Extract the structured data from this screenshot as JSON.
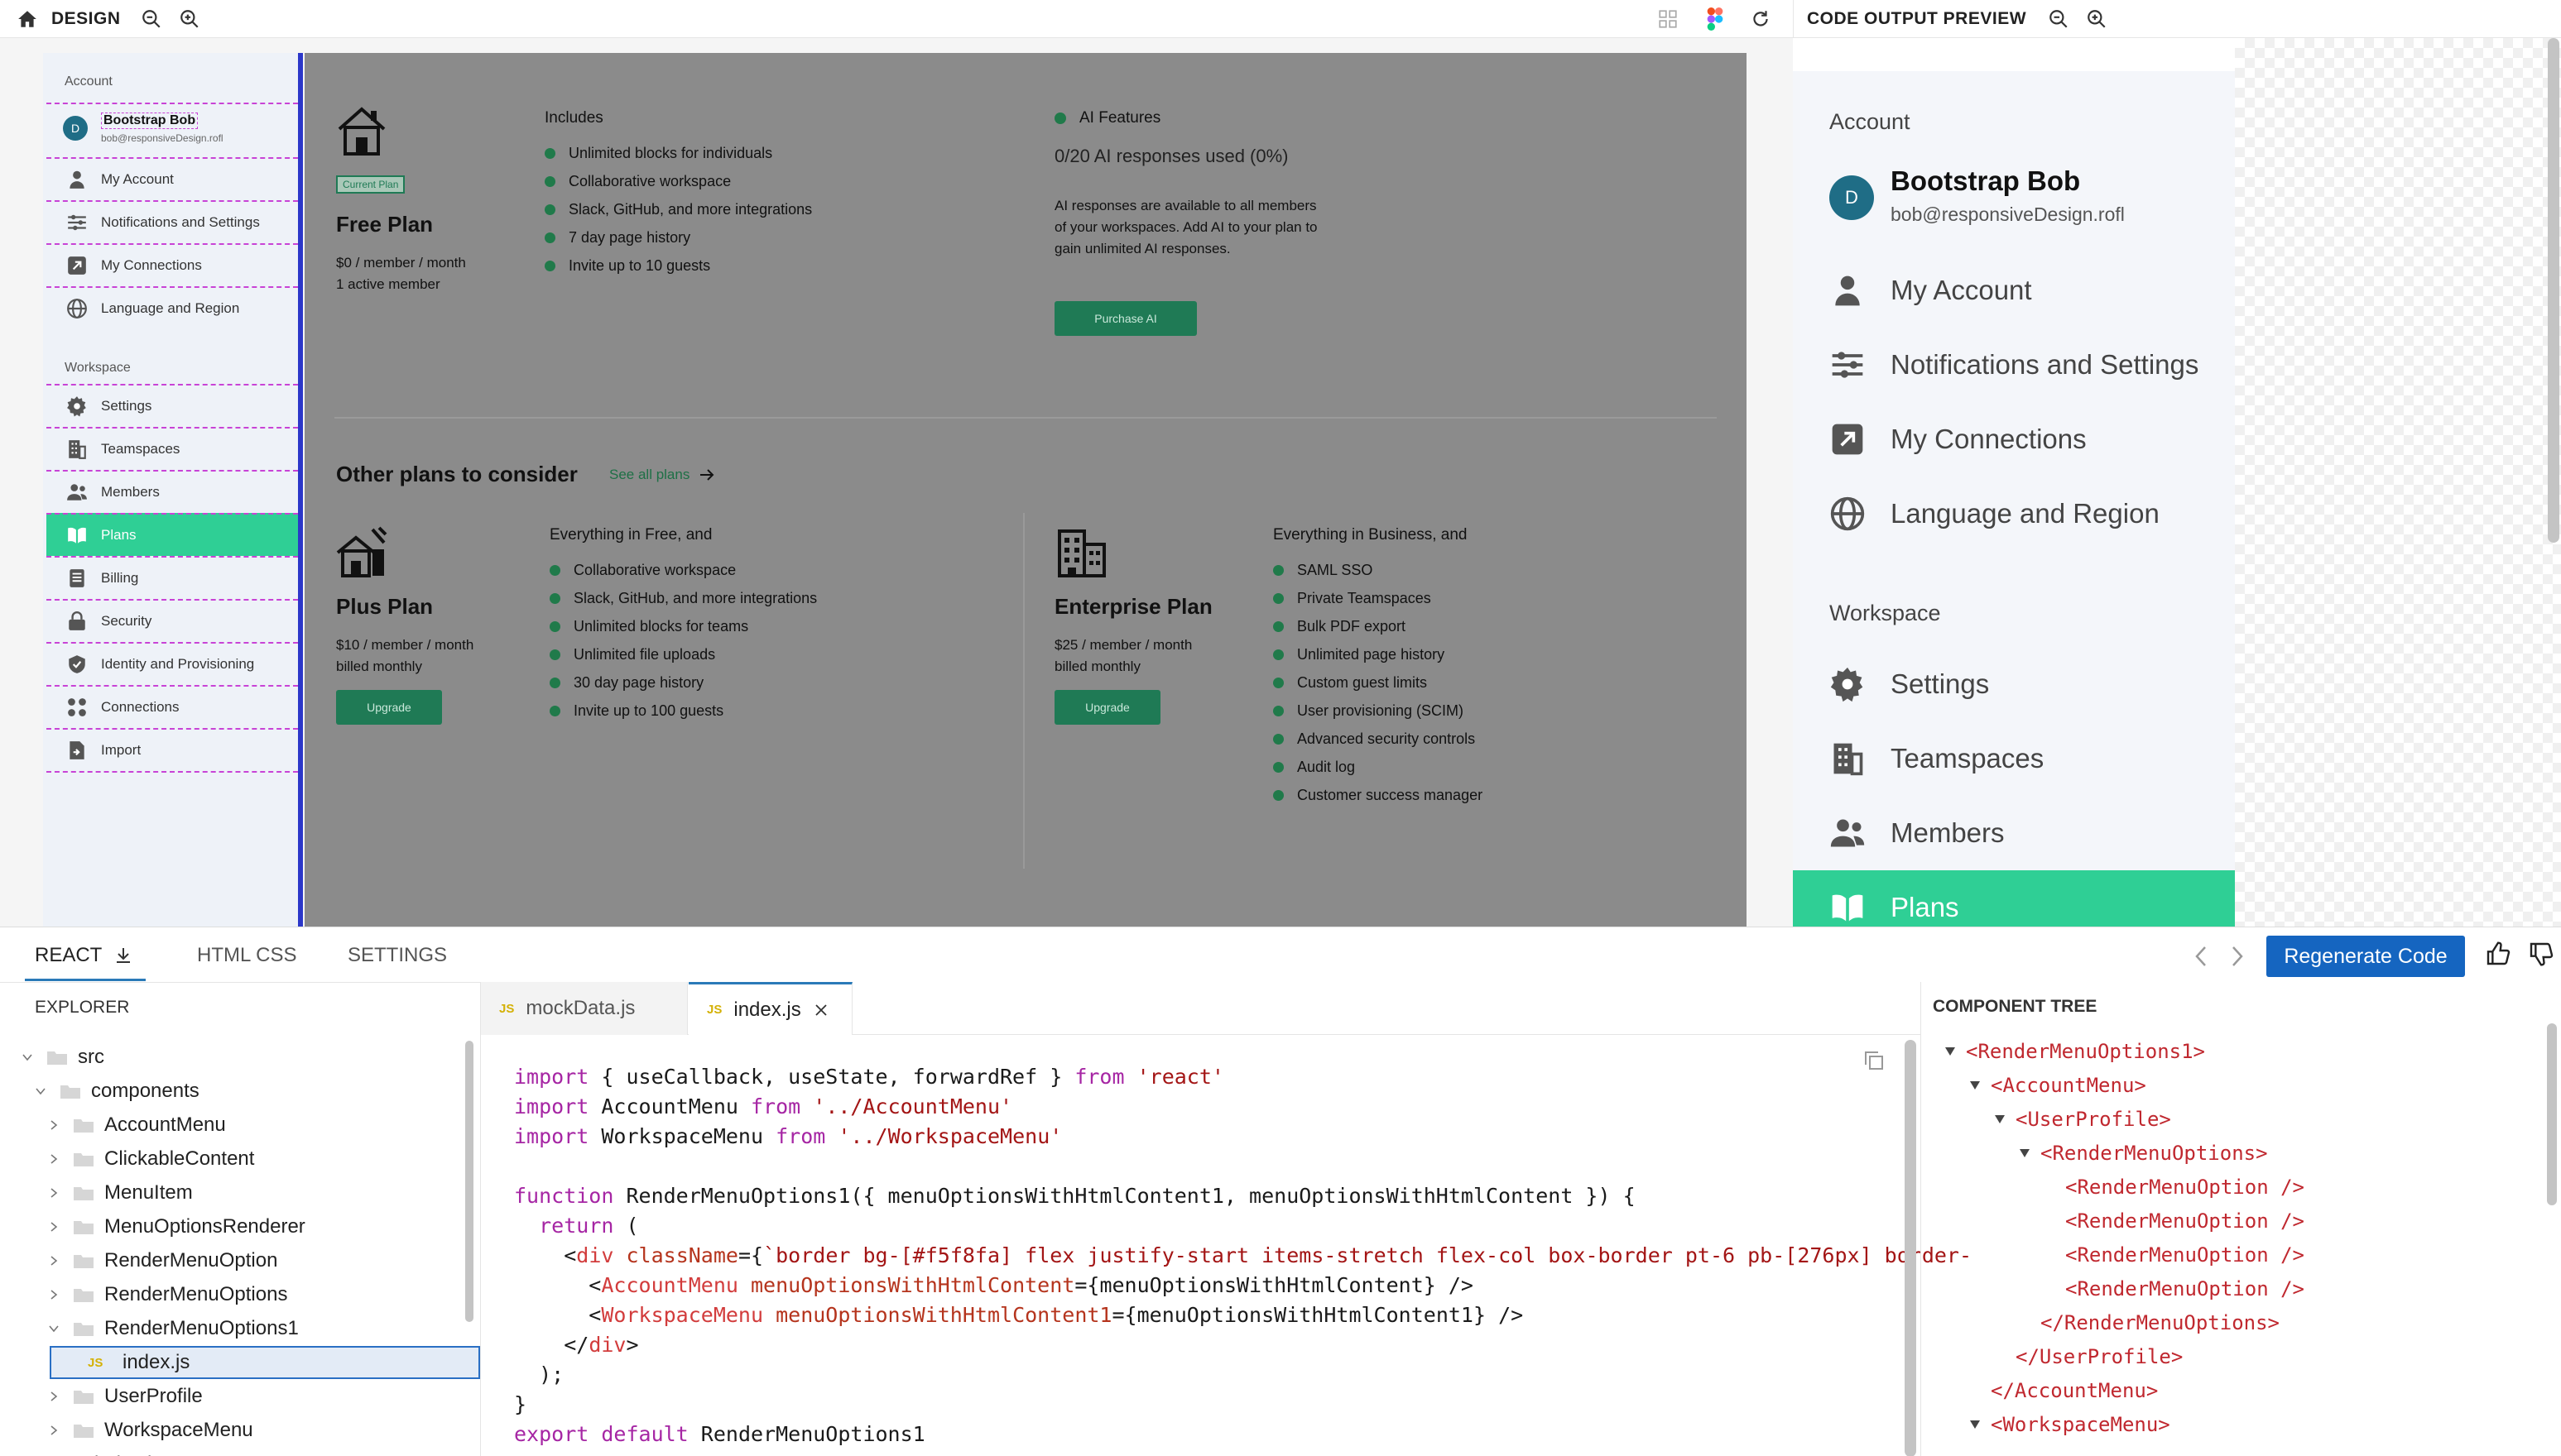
{
  "design_bar": {
    "title": "DESIGN"
  },
  "preview_bar": {
    "title": "CODE OUTPUT PREVIEW"
  },
  "design_sidebar": {
    "account_label": "Account",
    "profile": {
      "initial": "D",
      "name": "Bootstrap Bob",
      "email": "bob@responsiveDesign.rofl"
    },
    "account_items": [
      "My Account",
      "Notifications and Settings",
      "My Connections",
      "Language and Region"
    ],
    "workspace_label": "Workspace",
    "workspace_items": [
      "Settings",
      "Teamspaces",
      "Members",
      "Plans",
      "Billing",
      "Security",
      "Identity and Provisioning",
      "Connections",
      "Import"
    ],
    "active_item": "Plans"
  },
  "plans": {
    "current_badge": "Current Plan",
    "free": {
      "name": "Free Plan",
      "price": "$0 / member / month",
      "members": "1 active member"
    },
    "includes_title": "Includes",
    "includes": [
      "Unlimited blocks for individuals",
      "Collaborative workspace",
      "Slack, GitHub, and more integrations",
      "7 day page history",
      "Invite up to 10 guests"
    ],
    "ai": {
      "title": "AI Features",
      "usage": "0/20 AI responses used (0%)",
      "description_lines": [
        "AI responses are available to all members",
        "of your workspaces. Add AI to your plan to",
        "gain unlimited AI responses."
      ],
      "button": "Purchase AI"
    },
    "other_title": "Other plans to consider",
    "see_all": "See all plans",
    "plus": {
      "name": "Plus Plan",
      "price": "$10 / member / month",
      "billing": "billed monthly",
      "button": "Upgrade",
      "features_title": "Everything in Free, and",
      "features": [
        "Collaborative workspace",
        "Slack, GitHub, and more integrations",
        "Unlimited blocks for teams",
        "Unlimited file uploads",
        "30 day page history",
        "Invite up to 100 guests"
      ]
    },
    "enterprise": {
      "name": "Enterprise Plan",
      "price": "$25 / member / month",
      "billing": "billed monthly",
      "button": "Upgrade",
      "features_title": "Everything in Business, and",
      "features": [
        "SAML SSO",
        "Private Teamspaces",
        "Bulk PDF export",
        "Unlimited page history",
        "Custom guest limits",
        "User provisioning (SCIM)",
        "Advanced security controls",
        "Audit log",
        "Customer success manager"
      ]
    }
  },
  "preview": {
    "account_label": "Account",
    "profile": {
      "initial": "D",
      "name": "Bootstrap Bob",
      "email": "bob@responsiveDesign.rofl"
    },
    "account_items": [
      "My Account",
      "Notifications and Settings",
      "My Connections",
      "Language and Region"
    ],
    "workspace_label": "Workspace",
    "workspace_items": [
      "Settings",
      "Teamspaces",
      "Members",
      "Plans"
    ],
    "active_item": "Plans"
  },
  "bottom_tabs": {
    "react": "REACT",
    "html_css": "HTML CSS",
    "settings": "SETTINGS"
  },
  "actions": {
    "regenerate": "Regenerate Code"
  },
  "explorer": {
    "title": "EXPLORER",
    "tree": [
      {
        "label": "src",
        "depth": 0,
        "type": "folder",
        "open": true
      },
      {
        "label": "components",
        "depth": 1,
        "type": "folder",
        "open": true
      },
      {
        "label": "AccountMenu",
        "depth": 2,
        "type": "folder",
        "open": false
      },
      {
        "label": "ClickableContent",
        "depth": 2,
        "type": "folder",
        "open": false
      },
      {
        "label": "MenuItem",
        "depth": 2,
        "type": "folder",
        "open": false
      },
      {
        "label": "MenuOptionsRenderer",
        "depth": 2,
        "type": "folder",
        "open": false
      },
      {
        "label": "RenderMenuOption",
        "depth": 2,
        "type": "folder",
        "open": false
      },
      {
        "label": "RenderMenuOptions",
        "depth": 2,
        "type": "folder",
        "open": false
      },
      {
        "label": "RenderMenuOptions1",
        "depth": 2,
        "type": "folder",
        "open": true
      },
      {
        "label": "index.js",
        "depth": 3,
        "type": "file",
        "selected": true
      },
      {
        "label": "UserProfile",
        "depth": 2,
        "type": "folder",
        "open": false
      },
      {
        "label": "WorkspaceMenu",
        "depth": 2,
        "type": "folder",
        "open": false
      },
      {
        "label": "index.js",
        "depth": 1,
        "type": "file"
      }
    ]
  },
  "editor": {
    "tabs": [
      {
        "label": "mockData.js",
        "active": false
      },
      {
        "label": "index.js",
        "active": true
      }
    ],
    "file_icon_label": "JS",
    "lines": [
      "import { useCallback, useState, forwardRef } from 'react'",
      "import AccountMenu from '../AccountMenu'",
      "import WorkspaceMenu from '../WorkspaceMenu'",
      "",
      "function RenderMenuOptions1({ menuOptionsWithHtmlContent1, menuOptionsWithHtmlContent }) {",
      "  return (",
      "    <div className={`border bg-[#f5f8fa] flex justify-start items-stretch flex-col box-border pt-6 pb-[276px] border-",
      "      <AccountMenu menuOptionsWithHtmlContent={menuOptionsWithHtmlContent} />",
      "      <WorkspaceMenu menuOptionsWithHtmlContent1={menuOptionsWithHtmlContent1} />",
      "    </div>",
      "  );",
      "}",
      "export default RenderMenuOptions1"
    ]
  },
  "component_tree": {
    "title": "COMPONENT TREE",
    "rows": [
      {
        "label": "<RenderMenuOptions1>",
        "depth": 0,
        "toggle": true
      },
      {
        "label": "<AccountMenu>",
        "depth": 1,
        "toggle": true
      },
      {
        "label": "<UserProfile>",
        "depth": 2,
        "toggle": true
      },
      {
        "label": "<RenderMenuOptions>",
        "depth": 3,
        "toggle": true
      },
      {
        "label": "<RenderMenuOption />",
        "depth": 4,
        "toggle": false
      },
      {
        "label": "<RenderMenuOption />",
        "depth": 4,
        "toggle": false
      },
      {
        "label": "<RenderMenuOption />",
        "depth": 4,
        "toggle": false
      },
      {
        "label": "<RenderMenuOption />",
        "depth": 4,
        "toggle": false
      },
      {
        "label": "</RenderMenuOptions>",
        "depth": 3,
        "toggle": false
      },
      {
        "label": "</UserProfile>",
        "depth": 2,
        "toggle": false
      },
      {
        "label": "</AccountMenu>",
        "depth": 1,
        "toggle": false
      },
      {
        "label": "<WorkspaceMenu>",
        "depth": 1,
        "toggle": true
      }
    ]
  },
  "colors": {
    "accent": "#2fcf95",
    "primary_button": "#1565c0",
    "selection_border": "#c843d6",
    "frame_border": "#2b37c9"
  }
}
